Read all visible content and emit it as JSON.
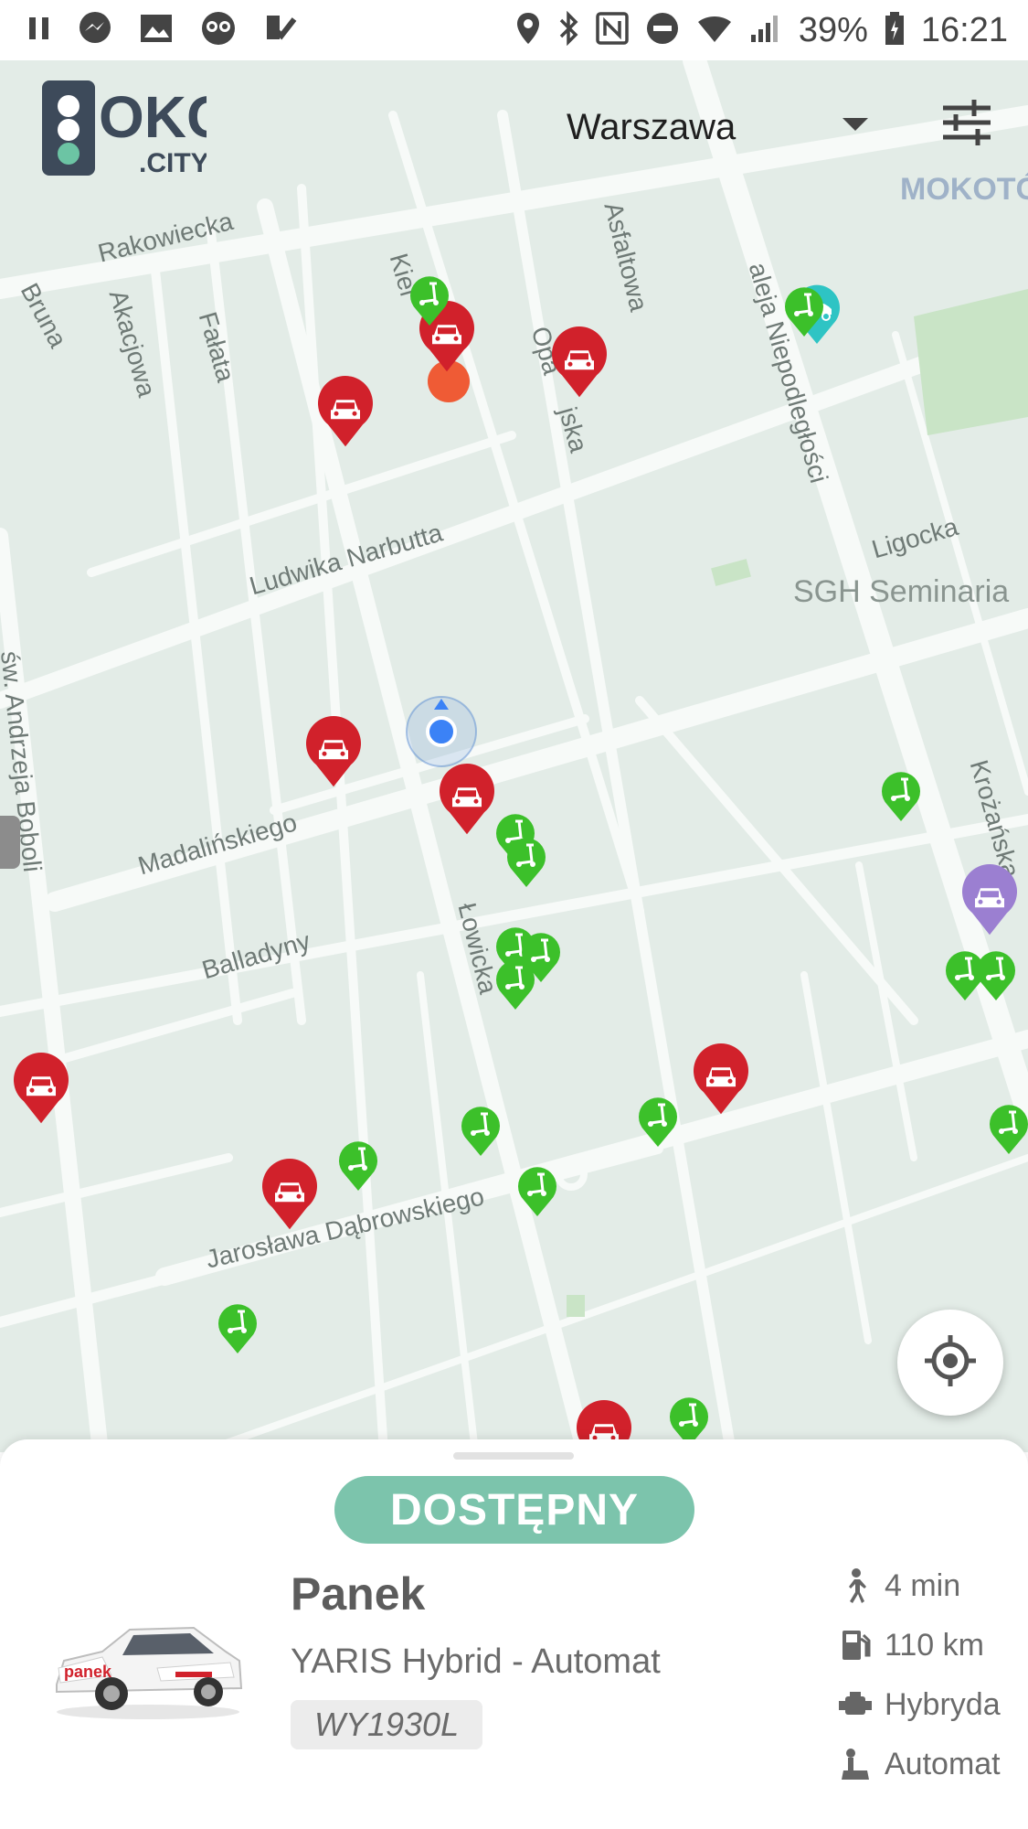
{
  "status_bar": {
    "left_icons": [
      "pause-icon",
      "messenger-icon",
      "gallery-icon",
      "owl-app-icon",
      "check-app-icon"
    ],
    "right_icons": [
      "location-icon",
      "bluetooth-icon",
      "nfc-icon",
      "dnd-icon",
      "wifi-icon",
      "signal-icon"
    ],
    "battery": "39%",
    "time": "16:21"
  },
  "header": {
    "logo_main": "OKO",
    "logo_sub": ".CITY",
    "city": "Warszawa",
    "filter_icon": "sliders-icon",
    "overlay_poi": "MOKOTÓ"
  },
  "map": {
    "streets": [
      "Bruna",
      "Rakowiecka",
      "Akacjowa",
      "Fałata",
      "Kiel",
      "Asfaltowa",
      "Opa",
      "jska",
      "aleja Niepodległości",
      "Ludwika Narbutta",
      "Ligocka",
      "św. Andrzeja Boboli",
      "Madalińskiego",
      "Łowicka",
      "Balladyny",
      "Krożańska",
      "Jarosława Dąbrowskiego"
    ],
    "pois": [
      "SGH Seminaria"
    ],
    "marker_types": [
      "car",
      "scooter",
      "ebike",
      "premium-car"
    ]
  },
  "locate_button_icon": "crosshair-icon",
  "sheet": {
    "status": "DOSTĘPNY",
    "operator": "Panek",
    "model": "YARIS Hybrid - Automat",
    "plate": "WY1930L",
    "car_logo": "panek",
    "specs": [
      {
        "icon": "walking-icon",
        "text": "4 min"
      },
      {
        "icon": "fuel-icon",
        "text": "110 km"
      },
      {
        "icon": "engine-icon",
        "text": "Hybryda"
      },
      {
        "icon": "gearbox-icon",
        "text": "Automat"
      }
    ]
  },
  "colors": {
    "car_marker": "#d1212b",
    "scooter_marker": "#3cc02a",
    "ebike_marker": "#2ec4c4",
    "premium_marker": "#9b7fd1",
    "status_pill": "#7cc4ac",
    "map_bg": "#e3ece7"
  }
}
